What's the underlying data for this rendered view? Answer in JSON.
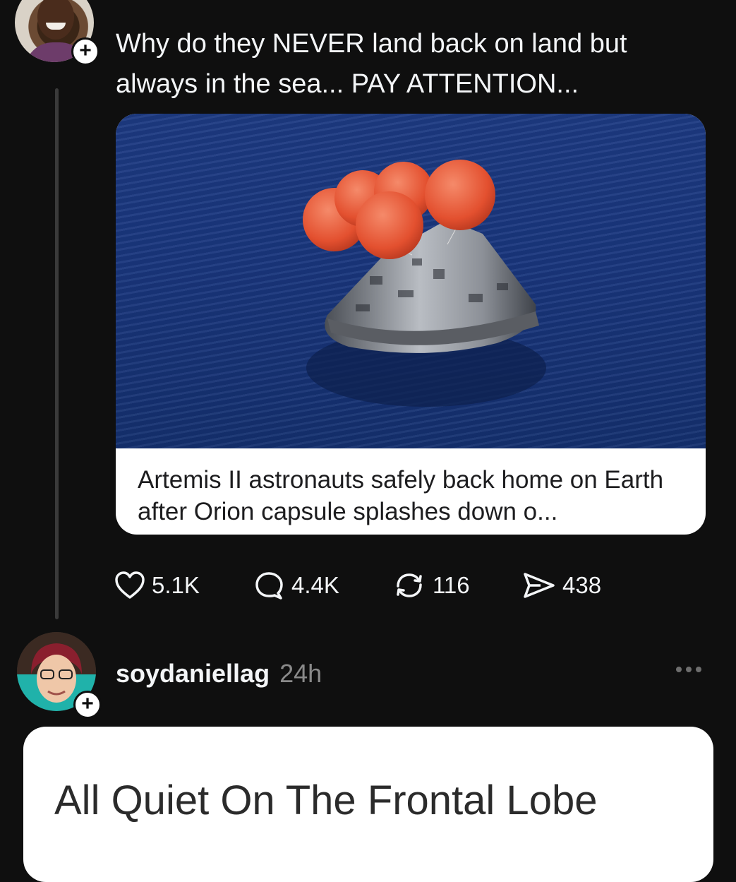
{
  "post1": {
    "author_avatar": "user-avatar",
    "text": "Why do they NEVER land back on land but always in the sea... PAY ATTENTION...",
    "link_card": {
      "image": "orion-capsule-splashdown-photo",
      "title": "Artemis II astronauts safely back home on Earth after Orion capsule splashes down o..."
    },
    "actions": {
      "likes": "5.1K",
      "replies": "4.4K",
      "reposts": "116",
      "shares": "438"
    }
  },
  "post2": {
    "username": "soydaniellag",
    "time": "24h",
    "card_text": "All Quiet On The Frontal Lobe"
  },
  "ui": {
    "follow_plus": "+"
  },
  "colors": {
    "background": "#0f0f0f",
    "text": "#f3f5f7",
    "muted": "#8a8a8a",
    "card": "#ffffff"
  }
}
